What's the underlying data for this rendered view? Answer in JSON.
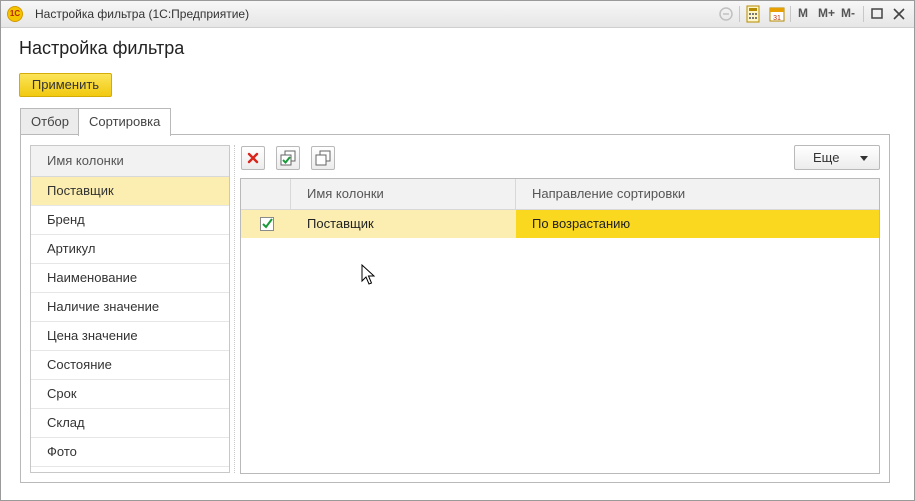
{
  "window": {
    "title": "Настройка фильтра  (1С:Предприятие)",
    "logo_text": "1С",
    "buttons": {
      "m": "M",
      "m_plus": "M+",
      "m_minus": "M-"
    }
  },
  "form": {
    "title": "Настройка фильтра",
    "apply_label": "Применить"
  },
  "tabs": [
    {
      "label": "Отбор",
      "active": false
    },
    {
      "label": "Сортировка",
      "active": true
    }
  ],
  "available_columns": {
    "header": "Имя колонки",
    "items": [
      "Поставщик",
      "Бренд",
      "Артикул",
      "Наименование",
      "Наличие значение",
      "Цена значение",
      "Состояние",
      "Срок",
      "Склад",
      "Фото"
    ],
    "selected_index": 0
  },
  "sort_toolbar": {
    "icons": [
      "delete-icon",
      "check-all-icon",
      "uncheck-all-icon"
    ],
    "more_label": "Еще"
  },
  "sort_table": {
    "headers": [
      "Имя колонки",
      "Направление сортировки"
    ],
    "rows": [
      {
        "checked": true,
        "column": "Поставщик",
        "direction": "По возрастанию"
      }
    ]
  },
  "colors": {
    "accent_yellow": "#f1c90f",
    "selected_row": "#fbeeb0",
    "selected_cell": "#fbd820"
  }
}
